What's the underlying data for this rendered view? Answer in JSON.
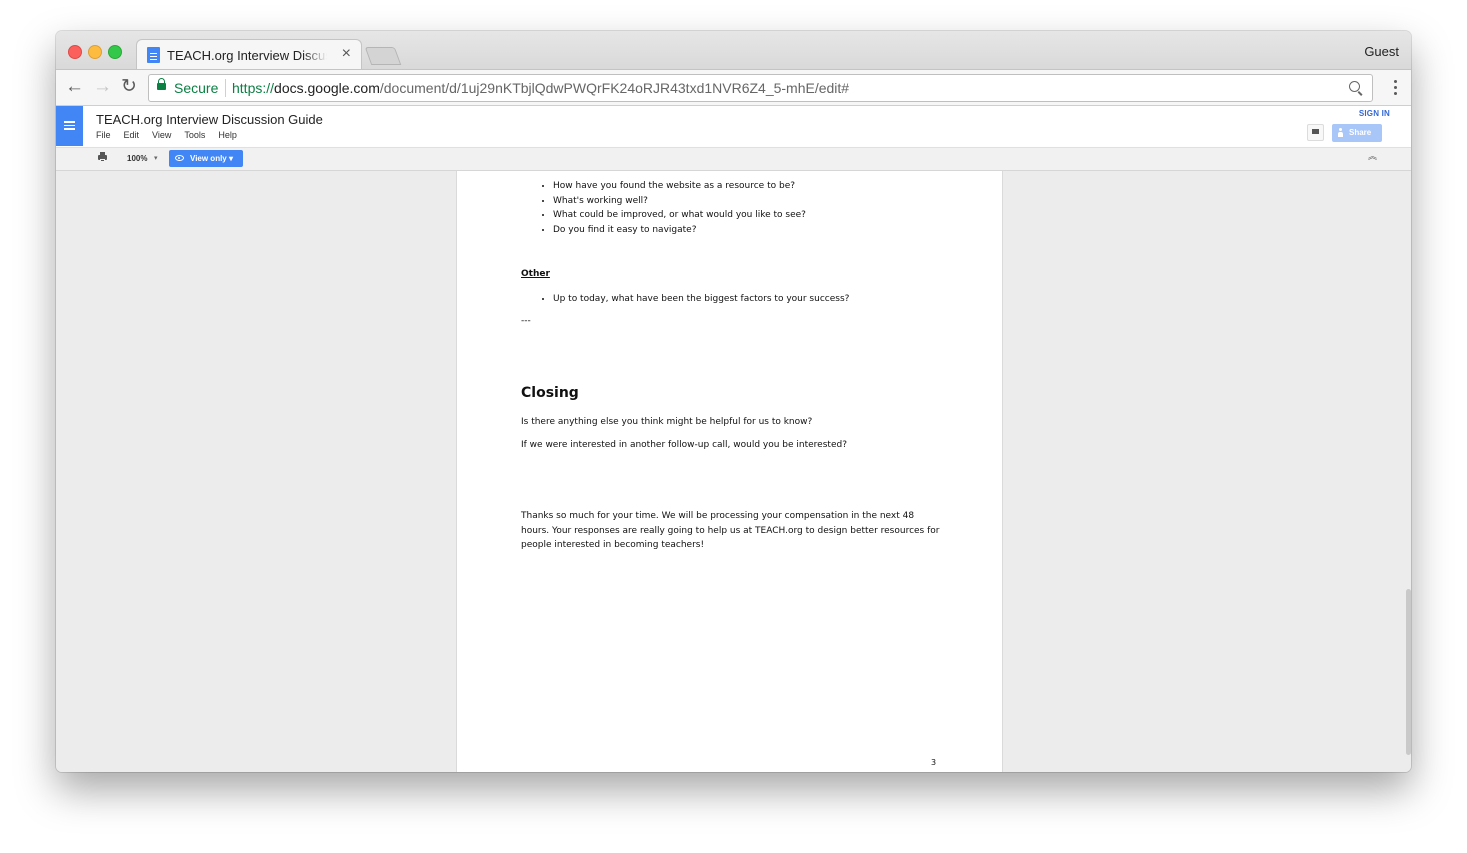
{
  "browser": {
    "tab_title": "TEACH.org Interview Discussion Guide",
    "tab_close": "×",
    "profile": "Guest",
    "secure_label": "Secure",
    "url_scheme": "https://",
    "url_host": "docs.google.com",
    "url_path": "/document/d/1uj29nKTbjlQdwPWQrFK24oRJR43txd1NVR6Z4_5-mhE/edit#",
    "nav": {
      "back": "←",
      "forward": "→",
      "reload": "↻"
    }
  },
  "docs": {
    "title": "TEACH.org Interview Discussion Guide",
    "menu": [
      "File",
      "Edit",
      "View",
      "Tools",
      "Help"
    ],
    "sign_in": "SIGN IN",
    "share": "Share",
    "zoom": "100%",
    "zoom_caret": "▾",
    "view_only": "View only ▾",
    "collapse": "︽"
  },
  "document": {
    "bullets_top": [
      "How have you found the website as a resource to be?",
      "What's working well?",
      "What could be improved, or what would you like to see?",
      "Do you find it easy to navigate?"
    ],
    "other_heading": "Other",
    "bullets_other": [
      "Up to today, what have been the biggest factors to your success?"
    ],
    "separator": "---",
    "closing_heading": "Closing",
    "closing_q1": "Is there anything else you think might be helpful for us to know?",
    "closing_q2": "If we were interested in another follow-up call, would you be interested?",
    "thanks": "Thanks so much for your time.  We will be processing your compensation in the next 48 hours.  Your responses are really going to help us at TEACH.org to design better resources for people interested in becoming teachers!",
    "page_number": "3"
  },
  "colors": {
    "docs_blue": "#4285f4",
    "secure_green": "#0b8043",
    "share_disabled": "#a9c6f8"
  }
}
